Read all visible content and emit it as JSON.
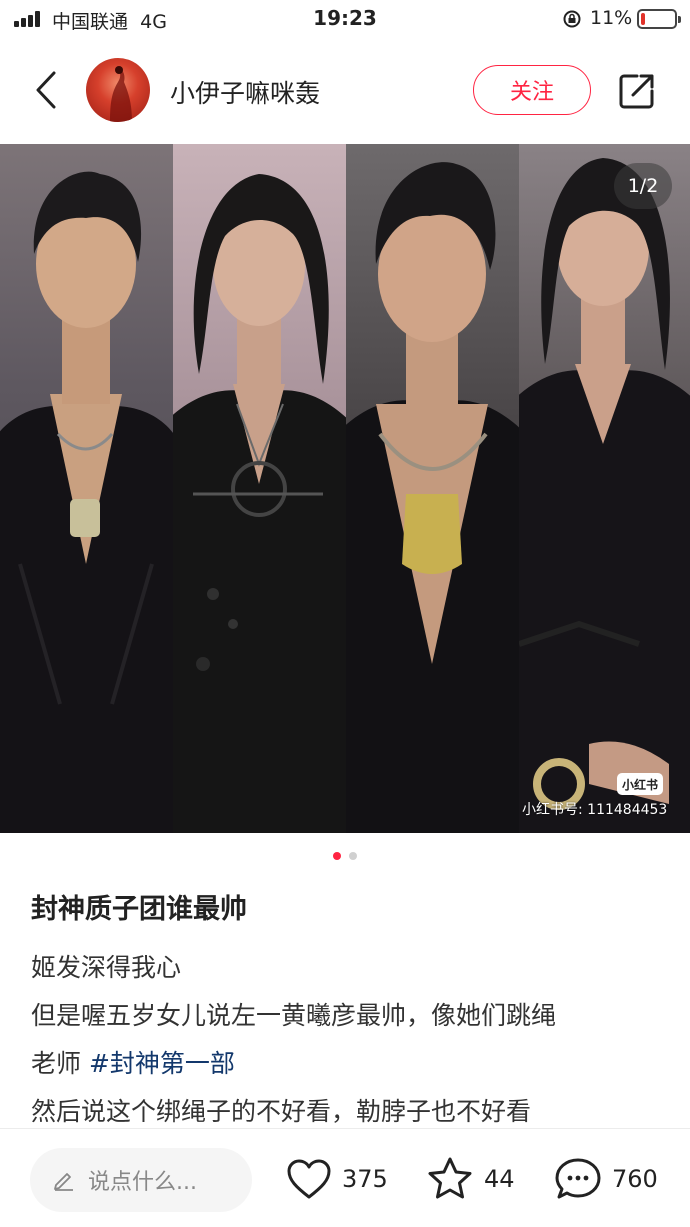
{
  "status_bar": {
    "carrier": "中国联通",
    "network": "4G",
    "time": "19:23",
    "battery": "11%",
    "battery_level": 0.11,
    "battery_color": "#e0322a"
  },
  "header": {
    "author_name": "小伊子嘛咪轰",
    "follow_label": "关注",
    "accent_color": "#ff2442"
  },
  "gallery": {
    "counter": "1/2",
    "watermark_logo": "小红书",
    "watermark_id": "小红书号: 111484453",
    "total": 2,
    "current": 1
  },
  "note": {
    "title": "封神质子团谁最帅",
    "line1": "姬发深得我心",
    "line2": "但是喔五岁女儿说左一黄曦彦最帅，像她们跳绳",
    "line3_text": "老师",
    "line3_hashtag": "#封神第一部",
    "line4": "然后说这个绑绳子的不好看，勒脖子也不好看",
    "hashtag_color": "#13386c"
  },
  "bottom_bar": {
    "comment_placeholder": "说点什么...",
    "likes": "375",
    "collects": "44",
    "comments": "760"
  },
  "icons": [
    "back-icon",
    "share-icon",
    "pencil-icon",
    "heart-icon",
    "star-icon",
    "comment-icon",
    "signal-icon",
    "rotation-lock-icon",
    "battery-icon"
  ]
}
